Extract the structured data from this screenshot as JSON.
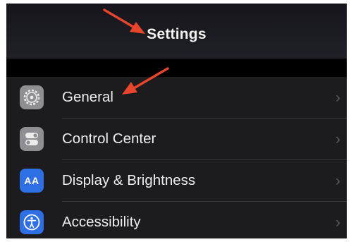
{
  "header": {
    "title": "Settings"
  },
  "settings": {
    "items": [
      {
        "label": "General",
        "icon": "gear-icon"
      },
      {
        "label": "Control Center",
        "icon": "toggle-switches-icon"
      },
      {
        "label": "Display & Brightness",
        "icon": "text-size-icon",
        "icon_text": "AA"
      },
      {
        "label": "Accessibility",
        "icon": "accessibility-icon"
      }
    ],
    "chevron": "›"
  },
  "colors": {
    "background": "#1c1c1e",
    "icon_gray": "#8e8e93",
    "icon_blue": "#2f6fe6",
    "annotation_arrow": "#e8452c"
  }
}
